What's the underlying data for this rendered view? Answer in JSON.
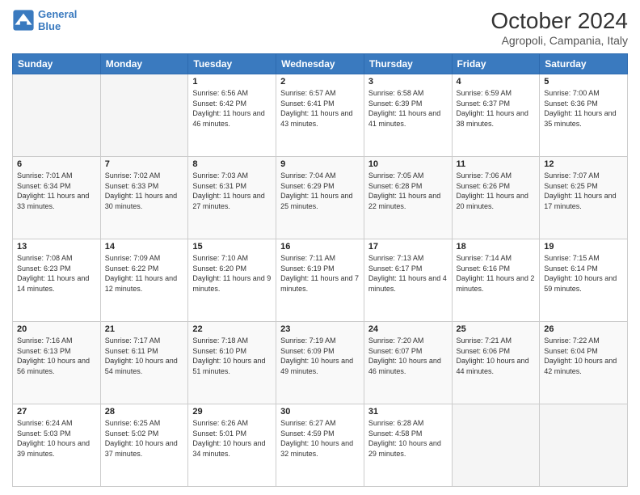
{
  "header": {
    "logo_line1": "General",
    "logo_line2": "Blue",
    "title": "October 2024",
    "subtitle": "Agropoli, Campania, Italy"
  },
  "days_of_week": [
    "Sunday",
    "Monday",
    "Tuesday",
    "Wednesday",
    "Thursday",
    "Friday",
    "Saturday"
  ],
  "weeks": [
    [
      {
        "day": "",
        "info": ""
      },
      {
        "day": "",
        "info": ""
      },
      {
        "day": "1",
        "info": "Sunrise: 6:56 AM\nSunset: 6:42 PM\nDaylight: 11 hours and 46 minutes."
      },
      {
        "day": "2",
        "info": "Sunrise: 6:57 AM\nSunset: 6:41 PM\nDaylight: 11 hours and 43 minutes."
      },
      {
        "day": "3",
        "info": "Sunrise: 6:58 AM\nSunset: 6:39 PM\nDaylight: 11 hours and 41 minutes."
      },
      {
        "day": "4",
        "info": "Sunrise: 6:59 AM\nSunset: 6:37 PM\nDaylight: 11 hours and 38 minutes."
      },
      {
        "day": "5",
        "info": "Sunrise: 7:00 AM\nSunset: 6:36 PM\nDaylight: 11 hours and 35 minutes."
      }
    ],
    [
      {
        "day": "6",
        "info": "Sunrise: 7:01 AM\nSunset: 6:34 PM\nDaylight: 11 hours and 33 minutes."
      },
      {
        "day": "7",
        "info": "Sunrise: 7:02 AM\nSunset: 6:33 PM\nDaylight: 11 hours and 30 minutes."
      },
      {
        "day": "8",
        "info": "Sunrise: 7:03 AM\nSunset: 6:31 PM\nDaylight: 11 hours and 27 minutes."
      },
      {
        "day": "9",
        "info": "Sunrise: 7:04 AM\nSunset: 6:29 PM\nDaylight: 11 hours and 25 minutes."
      },
      {
        "day": "10",
        "info": "Sunrise: 7:05 AM\nSunset: 6:28 PM\nDaylight: 11 hours and 22 minutes."
      },
      {
        "day": "11",
        "info": "Sunrise: 7:06 AM\nSunset: 6:26 PM\nDaylight: 11 hours and 20 minutes."
      },
      {
        "day": "12",
        "info": "Sunrise: 7:07 AM\nSunset: 6:25 PM\nDaylight: 11 hours and 17 minutes."
      }
    ],
    [
      {
        "day": "13",
        "info": "Sunrise: 7:08 AM\nSunset: 6:23 PM\nDaylight: 11 hours and 14 minutes."
      },
      {
        "day": "14",
        "info": "Sunrise: 7:09 AM\nSunset: 6:22 PM\nDaylight: 11 hours and 12 minutes."
      },
      {
        "day": "15",
        "info": "Sunrise: 7:10 AM\nSunset: 6:20 PM\nDaylight: 11 hours and 9 minutes."
      },
      {
        "day": "16",
        "info": "Sunrise: 7:11 AM\nSunset: 6:19 PM\nDaylight: 11 hours and 7 minutes."
      },
      {
        "day": "17",
        "info": "Sunrise: 7:13 AM\nSunset: 6:17 PM\nDaylight: 11 hours and 4 minutes."
      },
      {
        "day": "18",
        "info": "Sunrise: 7:14 AM\nSunset: 6:16 PM\nDaylight: 11 hours and 2 minutes."
      },
      {
        "day": "19",
        "info": "Sunrise: 7:15 AM\nSunset: 6:14 PM\nDaylight: 10 hours and 59 minutes."
      }
    ],
    [
      {
        "day": "20",
        "info": "Sunrise: 7:16 AM\nSunset: 6:13 PM\nDaylight: 10 hours and 56 minutes."
      },
      {
        "day": "21",
        "info": "Sunrise: 7:17 AM\nSunset: 6:11 PM\nDaylight: 10 hours and 54 minutes."
      },
      {
        "day": "22",
        "info": "Sunrise: 7:18 AM\nSunset: 6:10 PM\nDaylight: 10 hours and 51 minutes."
      },
      {
        "day": "23",
        "info": "Sunrise: 7:19 AM\nSunset: 6:09 PM\nDaylight: 10 hours and 49 minutes."
      },
      {
        "day": "24",
        "info": "Sunrise: 7:20 AM\nSunset: 6:07 PM\nDaylight: 10 hours and 46 minutes."
      },
      {
        "day": "25",
        "info": "Sunrise: 7:21 AM\nSunset: 6:06 PM\nDaylight: 10 hours and 44 minutes."
      },
      {
        "day": "26",
        "info": "Sunrise: 7:22 AM\nSunset: 6:04 PM\nDaylight: 10 hours and 42 minutes."
      }
    ],
    [
      {
        "day": "27",
        "info": "Sunrise: 6:24 AM\nSunset: 5:03 PM\nDaylight: 10 hours and 39 minutes."
      },
      {
        "day": "28",
        "info": "Sunrise: 6:25 AM\nSunset: 5:02 PM\nDaylight: 10 hours and 37 minutes."
      },
      {
        "day": "29",
        "info": "Sunrise: 6:26 AM\nSunset: 5:01 PM\nDaylight: 10 hours and 34 minutes."
      },
      {
        "day": "30",
        "info": "Sunrise: 6:27 AM\nSunset: 4:59 PM\nDaylight: 10 hours and 32 minutes."
      },
      {
        "day": "31",
        "info": "Sunrise: 6:28 AM\nSunset: 4:58 PM\nDaylight: 10 hours and 29 minutes."
      },
      {
        "day": "",
        "info": ""
      },
      {
        "day": "",
        "info": ""
      }
    ]
  ]
}
